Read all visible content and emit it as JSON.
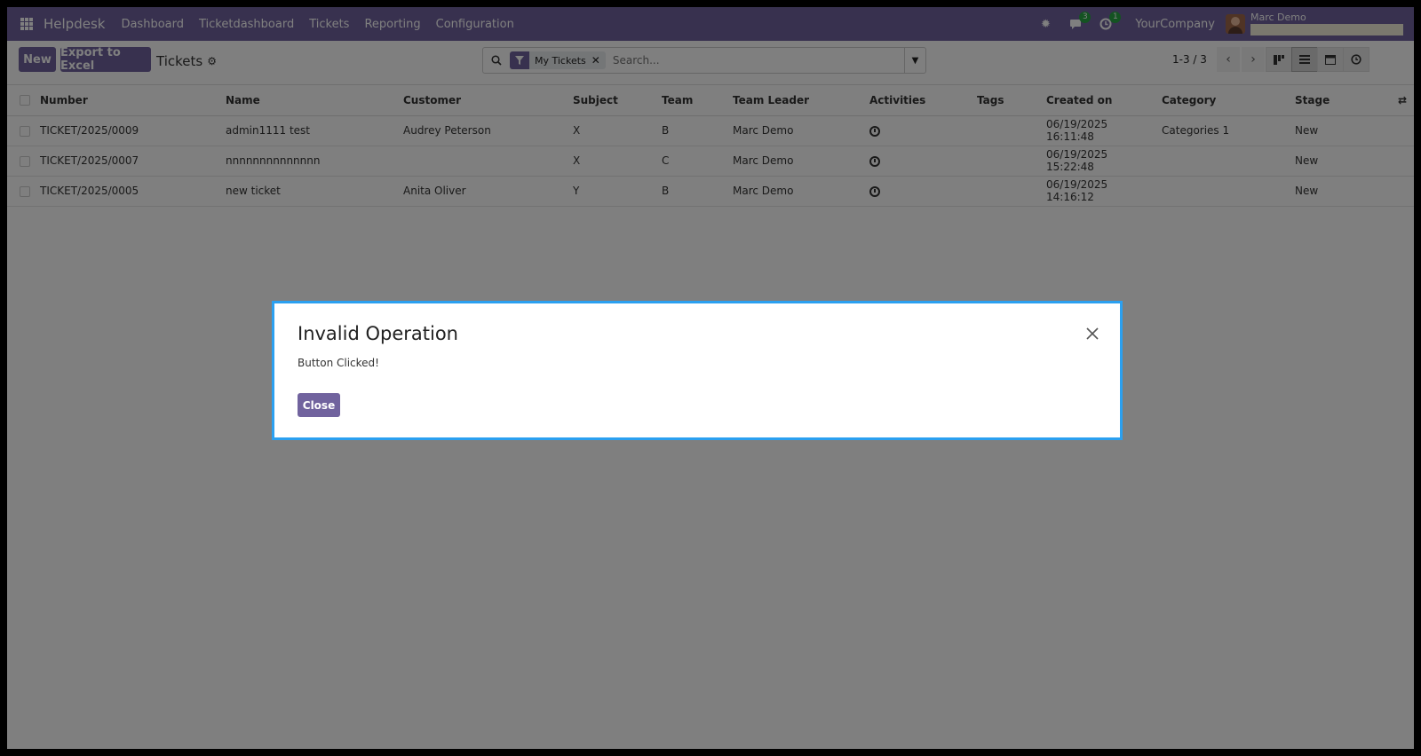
{
  "navbar": {
    "app_name": "Helpdesk",
    "menu": [
      "Dashboard",
      "Ticketdashboard",
      "Tickets",
      "Reporting",
      "Configuration"
    ],
    "messages_count": "3",
    "activities_count": "1",
    "company": "YourCompany",
    "user": "Marc Demo"
  },
  "control": {
    "new_label": "New",
    "export_label": "Export to Excel",
    "title": "Tickets",
    "facet_label": "My Tickets",
    "search_placeholder": "Search...",
    "pager": "1-3 / 3"
  },
  "table": {
    "columns": [
      "Number",
      "Name",
      "Customer",
      "Subject",
      "Team",
      "Team Leader",
      "Activities",
      "Tags",
      "Created on",
      "Category",
      "Stage"
    ],
    "rows": [
      {
        "number": "TICKET/2025/0009",
        "name": "admin1111 test",
        "customer": "Audrey Peterson",
        "subject": "X",
        "team": "B",
        "leader": "Marc Demo",
        "tags": "",
        "created": "06/19/2025 16:11:48",
        "category": "Categories 1",
        "stage": "New"
      },
      {
        "number": "TICKET/2025/0007",
        "name": "nnnnnnnnnnnnnn",
        "customer": "",
        "subject": "X",
        "team": "C",
        "leader": "Marc Demo",
        "tags": "",
        "created": "06/19/2025 15:22:48",
        "category": "",
        "stage": "New"
      },
      {
        "number": "TICKET/2025/0005",
        "name": "new ticket",
        "customer": "Anita Oliver",
        "subject": "Y",
        "team": "B",
        "leader": "Marc Demo",
        "tags": "",
        "created": "06/19/2025 14:16:12",
        "category": "",
        "stage": "New"
      }
    ]
  },
  "modal": {
    "title": "Invalid Operation",
    "body": "Button Clicked!",
    "close_label": "Close"
  },
  "colors": {
    "brand": "#71639e",
    "modal_border": "#2ba0f0",
    "badge": "#28a745"
  }
}
